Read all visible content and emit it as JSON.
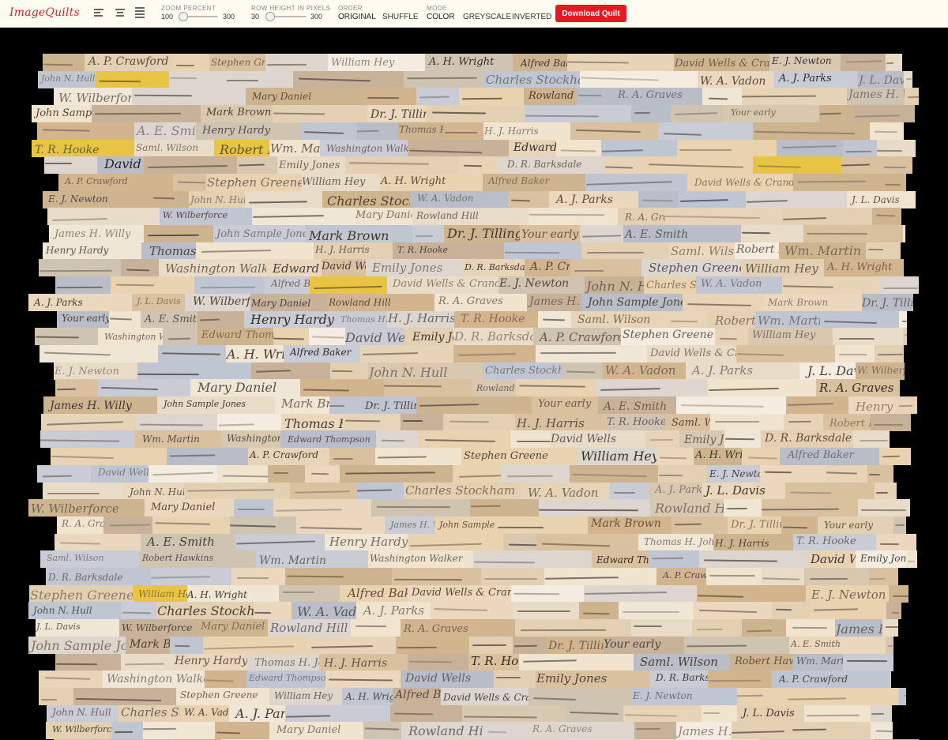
{
  "app": {
    "logo": "ImageQuilts"
  },
  "toolbar": {
    "zoom": {
      "label": "ZOOM PERCENT",
      "min": "100",
      "max": "300",
      "value": 100
    },
    "row_height": {
      "label": "ROW HEIGHT IN PIXELS",
      "min": "30",
      "max": "300",
      "value": 30
    },
    "order": {
      "label": "ORDER",
      "options": [
        "ORIGINAL",
        "SHUFFLE"
      ],
      "selected": "ORIGINAL"
    },
    "mode": {
      "label": "MODE",
      "options": [
        "COLOR",
        "GREYSCALE",
        "INVERTED"
      ],
      "selected": "COLOR"
    },
    "download_label": "Download Quilt"
  },
  "colors": {
    "brand": "#d81f2a",
    "button": "#e5191f",
    "toolbar_bg": "#fdfcf1",
    "background": "#000000"
  },
  "quilt": {
    "tile_labels": [
      "A. P. Crawford",
      "Stephen Greene",
      "William Hey",
      "A. H. Wright",
      "Alfred Baker",
      "David Wells & Crandall",
      "E. J. Newton",
      "John N. Hull",
      "Charles Stockham",
      "W. A. Vadon",
      "A. J. Parks",
      "J. L. Davis",
      "W. Wilberforce",
      "Mary Daniel",
      "Rowland Hill",
      "R. A. Graves",
      "James H. Willy",
      "John Sample Jones",
      "Mark Brown",
      "Dr. J. Tillinghast",
      "Your early",
      "A. E. Smith",
      "Henry Hardy",
      "Thomas H. Johnson",
      "H. J. Harris",
      "T. R. Hooke",
      "Saml. Wilson",
      "Robert Hawkins",
      "Wm. Martin",
      "Washington Walker",
      "Edward Thompson",
      "David Wells",
      "Emily Jones",
      "D. R. Barksdale"
    ]
  }
}
